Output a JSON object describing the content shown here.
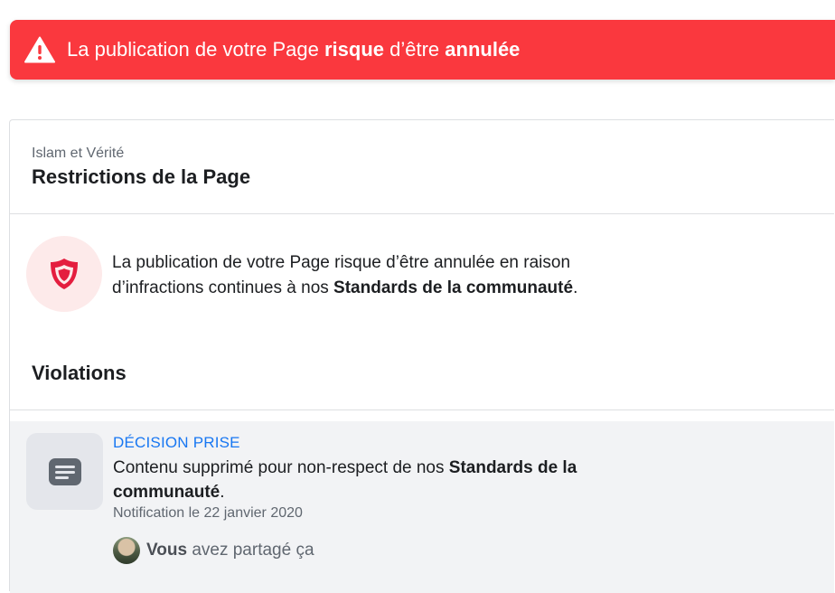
{
  "banner": {
    "icon": "warning-icon",
    "text_before": "La publication de votre Page ",
    "bold_1": "risque",
    "text_middle": " d’être ",
    "bold_2": "annulée",
    "color": "#fa383e"
  },
  "card": {
    "page_name": "Islam et Vérité",
    "title": "Restrictions de la Page"
  },
  "restriction": {
    "icon": "shield-icon",
    "text_before": "La publication de votre Page risque d’être annulée en raison d’infractions continues à nos ",
    "link": "Standards de la communauté",
    "text_after": "."
  },
  "violations": {
    "title": "Violations",
    "items": [
      {
        "icon": "document-icon",
        "status": "DÉCISION PRISE",
        "desc_before": "Contenu supprimé pour non-respect de nos ",
        "desc_bold": "Standards de la communauté",
        "desc_after": ".",
        "date": "Notification le 22 janvier 2020",
        "share_bold": "Vous",
        "share_rest": " avez partagé ça"
      }
    ]
  },
  "colors": {
    "status_blue": "#1877f2",
    "shield_red": "#e41e3f",
    "row_bg": "#f2f3f5"
  }
}
